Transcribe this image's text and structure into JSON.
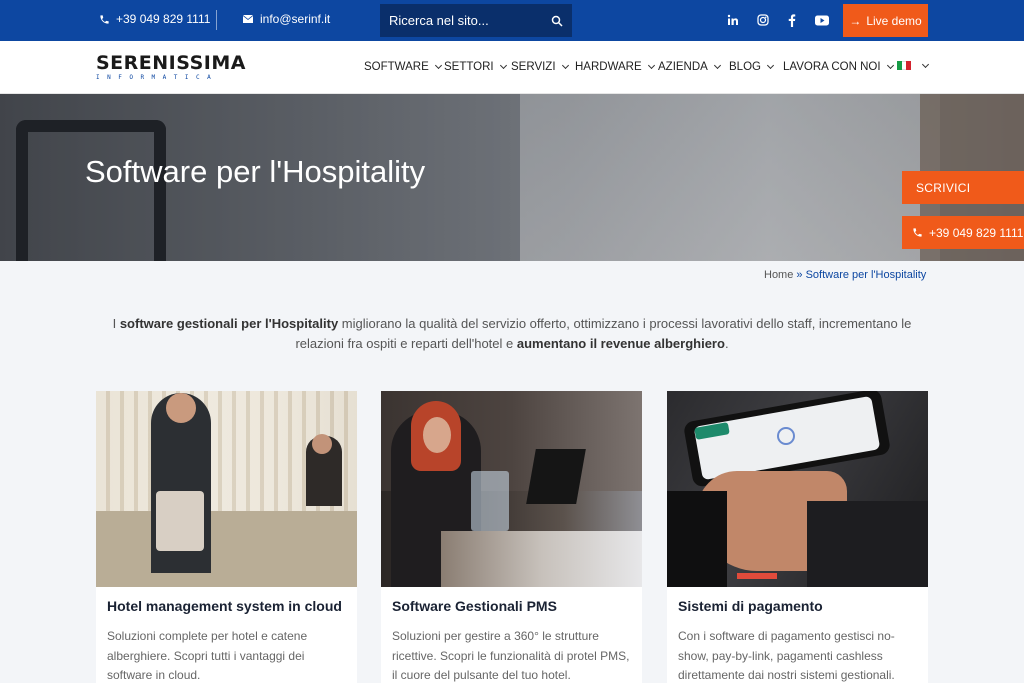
{
  "topbar": {
    "phone": "+39 049 829 1111",
    "email": "info@serinf.it",
    "search_placeholder": "Ricerca nel sito...",
    "social_icons": [
      "linkedin-icon",
      "instagram-icon",
      "facebook-icon",
      "youtube-icon"
    ],
    "live_demo": "Live demo"
  },
  "logo": {
    "line1": "SERENISSIMA",
    "line2": "INFORMATICA"
  },
  "nav": {
    "items": [
      {
        "label": "SOFTWARE"
      },
      {
        "label": "SETTORI"
      },
      {
        "label": "SERVIZI"
      },
      {
        "label": "HARDWARE"
      },
      {
        "label": "AZIENDA"
      },
      {
        "label": "BLOG"
      },
      {
        "label": "LAVORA CON NOI"
      }
    ],
    "language_flag": "flag-italy-icon"
  },
  "hero": {
    "title": "Software per l'Hospitality"
  },
  "floating": {
    "scrivi": "SCRIVICI",
    "phone": "+39 049 829 1111"
  },
  "breadcrumb": {
    "home": "Home",
    "separator": "»",
    "current": "Software per l'Hospitality"
  },
  "intro": {
    "p1": "I ",
    "b1": "software gestionali per l'Hospitality",
    "p2": " migliorano la qualità del servizio offerto, ottimizzano i processi lavorativi dello staff, incrementano le relazioni fra ospiti e reparti dell'hotel e ",
    "b2": "aumentano il revenue alberghiero",
    "p3": "."
  },
  "cards": [
    {
      "title": "Hotel management system in cloud",
      "text": "Soluzioni complete per hotel e catene alberghiere. Scopri tutti i vantaggi dei software in cloud."
    },
    {
      "title": "Software Gestionali PMS",
      "text": "Soluzioni per gestire a 360° le strutture ricettive. Scopri le funzionalità di protel PMS, il cuore del pulsante del tuo hotel."
    },
    {
      "title": "Sistemi di pagamento",
      "text": "Con i software di pagamento gestisci no-show, pay-by-link, pagamenti cashless direttamente dai nostri sistemi gestionali."
    }
  ],
  "colors": {
    "brand_blue": "#0d47a1",
    "accent_orange": "#f05a1a"
  }
}
